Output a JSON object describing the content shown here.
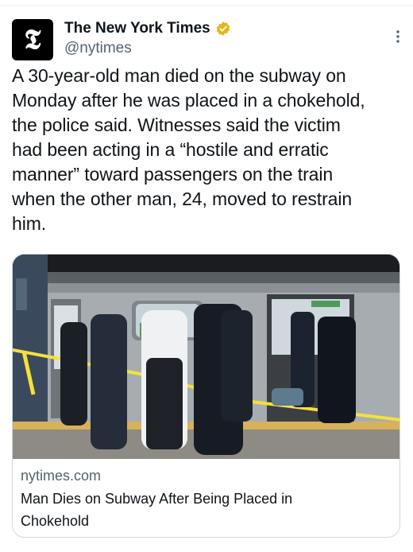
{
  "tweet": {
    "author": {
      "display_name": "The New York Times",
      "handle": "@nytimes",
      "avatar_glyph": "𝕿",
      "verified_badge": "gold-check-icon"
    },
    "text": "A 30-year-old man died on the subway on\nMonday after he was placed in a chokehold,\nthe police said. Witnesses said the victim\nhad been acting in a “hostile and erratic\nmanner” toward passengers on the train\nwhen the other man, 24, moved to restrain\nhim."
  },
  "link_card": {
    "domain": "nytimes.com",
    "title": "Man Dies on Subway After Being Placed in\nChokehold",
    "image_description_icon": "subway-photo"
  },
  "colors": {
    "text_primary": "#0f1419",
    "text_secondary": "#536471",
    "border": "#cfd9de",
    "verified_gold": "#e2b719"
  }
}
